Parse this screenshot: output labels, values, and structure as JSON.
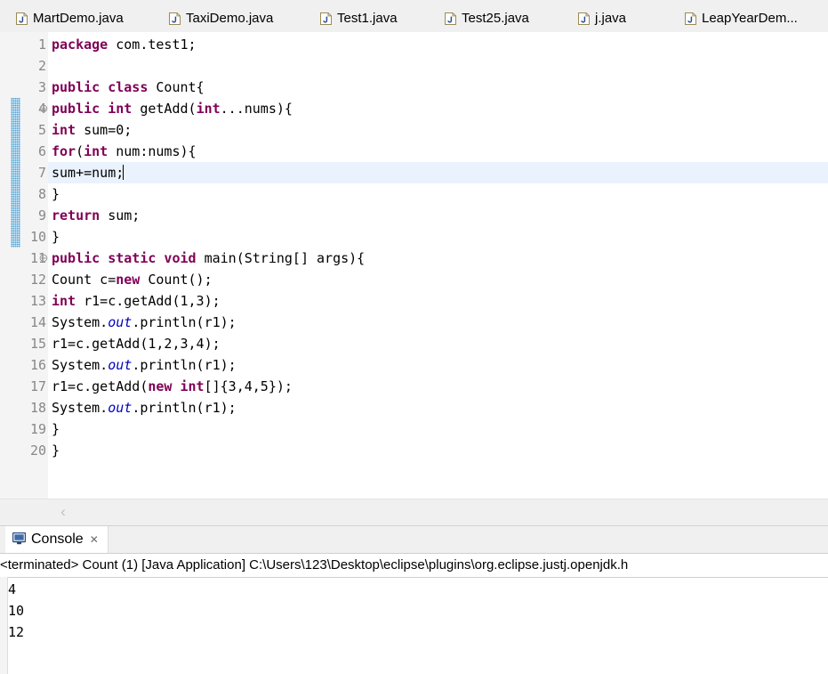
{
  "editor": {
    "tabs": [
      {
        "label": "MartDemo.java",
        "icon": "java-file-icon",
        "active": false
      },
      {
        "label": "TaxiDemo.java",
        "icon": "java-file-icon",
        "active": false
      },
      {
        "label": "Test1.java",
        "icon": "java-file-icon",
        "active": false
      },
      {
        "label": "Test25.java",
        "icon": "java-file-icon",
        "active": false
      },
      {
        "label": "j.java",
        "icon": "java-file-icon",
        "active": false
      },
      {
        "label": "LeapYearDem...",
        "icon": "java-file-icon",
        "active": false
      }
    ],
    "current_line": 7,
    "change_bar_lines": [
      4,
      10
    ],
    "fold_markers": [
      4,
      11
    ],
    "scroll_left_arrow": "‹",
    "lines": [
      {
        "n": 1,
        "fold": "",
        "tokens": [
          {
            "t": "package",
            "c": "kw"
          },
          {
            "t": " com.test1;",
            "c": "pl"
          }
        ]
      },
      {
        "n": 2,
        "fold": "",
        "tokens": []
      },
      {
        "n": 3,
        "fold": "",
        "tokens": [
          {
            "t": "public class",
            "c": "kw"
          },
          {
            "t": " Count{",
            "c": "pl"
          }
        ]
      },
      {
        "n": 4,
        "fold": "⊖",
        "tokens": [
          {
            "t": "public int",
            "c": "kw"
          },
          {
            "t": " getAdd(",
            "c": "pl"
          },
          {
            "t": "int",
            "c": "kw"
          },
          {
            "t": "...nums){",
            "c": "pl"
          }
        ]
      },
      {
        "n": 5,
        "fold": "",
        "tokens": [
          {
            "t": "int",
            "c": "kw"
          },
          {
            "t": " sum=0;",
            "c": "pl"
          }
        ]
      },
      {
        "n": 6,
        "fold": "",
        "tokens": [
          {
            "t": "for",
            "c": "kw"
          },
          {
            "t": "(",
            "c": "pl"
          },
          {
            "t": "int",
            "c": "kw"
          },
          {
            "t": " num:nums){",
            "c": "pl"
          }
        ]
      },
      {
        "n": 7,
        "fold": "",
        "tokens": [
          {
            "t": "sum+=num;",
            "c": "pl"
          }
        ],
        "caret": true
      },
      {
        "n": 8,
        "fold": "",
        "tokens": [
          {
            "t": "}",
            "c": "pl"
          }
        ]
      },
      {
        "n": 9,
        "fold": "",
        "tokens": [
          {
            "t": "return",
            "c": "kw"
          },
          {
            "t": " sum;",
            "c": "pl"
          }
        ]
      },
      {
        "n": 10,
        "fold": "",
        "tokens": [
          {
            "t": "}",
            "c": "pl"
          }
        ]
      },
      {
        "n": 11,
        "fold": "⊖",
        "tokens": [
          {
            "t": "public static void",
            "c": "kw"
          },
          {
            "t": " main(String[] args){",
            "c": "pl"
          }
        ]
      },
      {
        "n": 12,
        "fold": "",
        "tokens": [
          {
            "t": "Count c=",
            "c": "pl"
          },
          {
            "t": "new",
            "c": "kw"
          },
          {
            "t": " Count();",
            "c": "pl"
          }
        ]
      },
      {
        "n": 13,
        "fold": "",
        "tokens": [
          {
            "t": "int",
            "c": "kw"
          },
          {
            "t": " r1=c.getAdd(1,3);",
            "c": "pl"
          }
        ]
      },
      {
        "n": 14,
        "fold": "",
        "tokens": [
          {
            "t": "System.",
            "c": "pl"
          },
          {
            "t": "out",
            "c": "fld"
          },
          {
            "t": ".println(r1);",
            "c": "pl"
          }
        ]
      },
      {
        "n": 15,
        "fold": "",
        "tokens": [
          {
            "t": "r1=c.getAdd(1,2,3,4);",
            "c": "pl"
          }
        ]
      },
      {
        "n": 16,
        "fold": "",
        "tokens": [
          {
            "t": "System.",
            "c": "pl"
          },
          {
            "t": "out",
            "c": "fld"
          },
          {
            "t": ".println(r1);",
            "c": "pl"
          }
        ]
      },
      {
        "n": 17,
        "fold": "",
        "tokens": [
          {
            "t": "r1=c.getAdd(",
            "c": "pl"
          },
          {
            "t": "new int",
            "c": "kw"
          },
          {
            "t": "[]{3,4,5});",
            "c": "pl"
          }
        ]
      },
      {
        "n": 18,
        "fold": "",
        "tokens": [
          {
            "t": "System.",
            "c": "pl"
          },
          {
            "t": "out",
            "c": "fld"
          },
          {
            "t": ".println(r1);",
            "c": "pl"
          }
        ]
      },
      {
        "n": 19,
        "fold": "",
        "tokens": [
          {
            "t": "}",
            "c": "pl"
          }
        ]
      },
      {
        "n": 20,
        "fold": "",
        "tokens": [
          {
            "t": "}",
            "c": "pl"
          }
        ]
      }
    ]
  },
  "console": {
    "tab_label": "Console",
    "tab_icon": "console-monitor-icon",
    "close_glyph": "✕",
    "header": "<terminated> Count (1) [Java Application] C:\\Users\\123\\Desktop\\eclipse\\plugins\\org.eclipse.justj.openjdk.h",
    "output": [
      "4",
      "10",
      "12"
    ]
  },
  "colors": {
    "keyword": "#7f0055",
    "static_field": "#0000c0",
    "current_line_highlight": "#eaf2fd",
    "change_bar": "#4a9fd4",
    "editor_background": "#ffffff",
    "chrome_background": "#f0f0f0"
  }
}
